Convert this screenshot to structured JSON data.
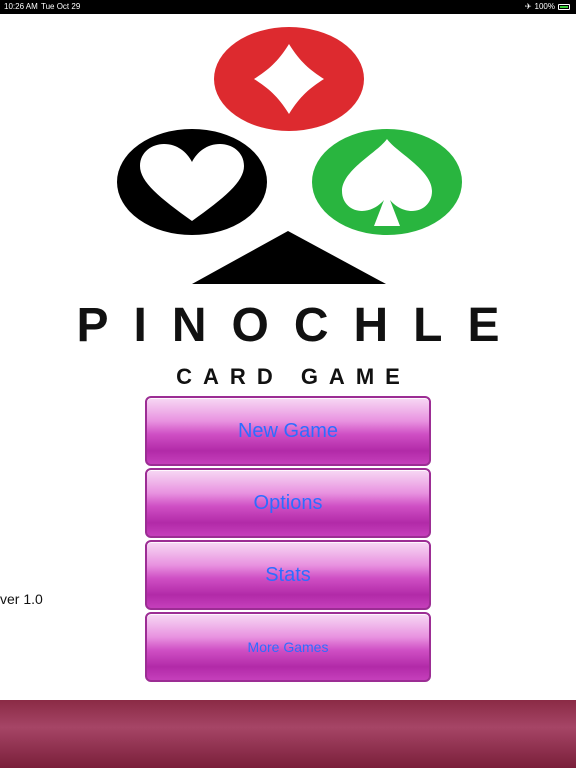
{
  "status_bar": {
    "time": "10:26 AM",
    "date": "Tue Oct 29",
    "battery": "100%"
  },
  "logo": {
    "suits": [
      "diamond-icon",
      "heart-icon",
      "spade-icon",
      "club-icon"
    ],
    "colors": {
      "diamond": "#dd2a2f",
      "heart": "#000000",
      "spade": "#29b53f",
      "club": "#000000"
    }
  },
  "title": {
    "main": "PINOCHLE",
    "sub": "CARD GAME"
  },
  "menu": {
    "new_game": "New Game",
    "options": "Options",
    "stats": "Stats",
    "more_games": "More Games"
  },
  "version": "ver 1.0",
  "colors": {
    "button_text": "#2d6dff",
    "button_fill": "#c53fbb",
    "bottom_bar": "#8a2a45"
  }
}
